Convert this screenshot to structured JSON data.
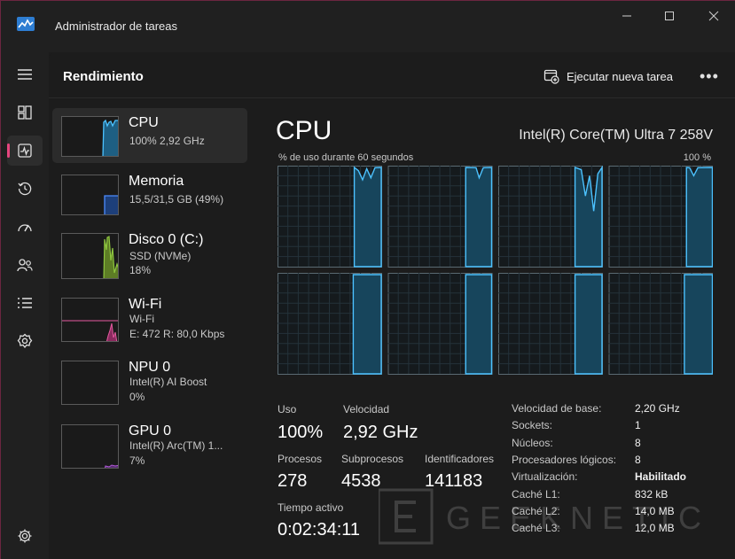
{
  "window": {
    "title": "Administrador de tareas",
    "minimize_glyph": "—",
    "maximize_glyph": "☐",
    "close_glyph": "✕"
  },
  "rail": {
    "items": [
      {
        "icon": "hamburger-icon"
      },
      {
        "icon": "processes-icon"
      },
      {
        "icon": "performance-icon",
        "active": true
      },
      {
        "icon": "history-icon"
      },
      {
        "icon": "startup-icon"
      },
      {
        "icon": "users-icon"
      },
      {
        "icon": "details-icon"
      },
      {
        "icon": "services-icon"
      },
      {
        "icon": "settings-icon"
      }
    ]
  },
  "header": {
    "title": "Rendimiento",
    "run_task_label": "Ejecutar nueva tarea",
    "more_label": "•••"
  },
  "devices": [
    {
      "name": "CPU",
      "line1": "100%  2,92 GHz",
      "line2": "",
      "color": "#4cc2ff"
    },
    {
      "name": "Memoria",
      "line1": "15,5/31,5 GB (49%)",
      "line2": "",
      "color": "#4c8cff"
    },
    {
      "name": "Disco 0 (C:)",
      "line1": "SSD (NVMe)",
      "line2": "18%",
      "color": "#8ec63f"
    },
    {
      "name": "Wi-Fi",
      "line1": "Wi-Fi",
      "line2": "E: 472  R: 80,0 Kbps",
      "color": "#e65aa0"
    },
    {
      "name": "NPU 0",
      "line1": "Intel(R) AI Boost",
      "line2": "0%",
      "color": "#4cc2ff"
    },
    {
      "name": "GPU 0",
      "line1": "Intel(R) Arc(TM) 1...",
      "line2": "7%",
      "color": "#b05ad8"
    }
  ],
  "detail": {
    "title": "CPU",
    "model": "Intel(R) Core(TM) Ultra 7 258V",
    "graph_label": "% de uso durante 60 segundos",
    "graph_max": "100 %",
    "graph_color": "#4cc2ff",
    "core_count_graphs": 8,
    "usage_label": "Uso",
    "usage_value": "100%",
    "speed_label": "Velocidad",
    "speed_value": "2,92 GHz",
    "processes_label": "Procesos",
    "processes_value": "278",
    "threads_label": "Subprocesos",
    "threads_value": "4538",
    "handles_label": "Identificadores",
    "handles_value": "141183",
    "uptime_label": "Tiempo activo",
    "uptime_value": "0:02:34:11",
    "specs": [
      {
        "k": "Velocidad de base:",
        "v": "2,20 GHz"
      },
      {
        "k": "Sockets:",
        "v": "1"
      },
      {
        "k": "Núcleos:",
        "v": "8"
      },
      {
        "k": "Procesadores lógicos:",
        "v": "8"
      },
      {
        "k": "Virtualización:",
        "v": "Habilitado",
        "bold": true
      },
      {
        "k": "Caché L1:",
        "v": "832 kB"
      },
      {
        "k": "Caché L2:",
        "v": "14,0 MB"
      },
      {
        "k": "Caché L3:",
        "v": "12,0 MB"
      }
    ]
  },
  "watermark": {
    "text": "GEEKNETIC"
  }
}
